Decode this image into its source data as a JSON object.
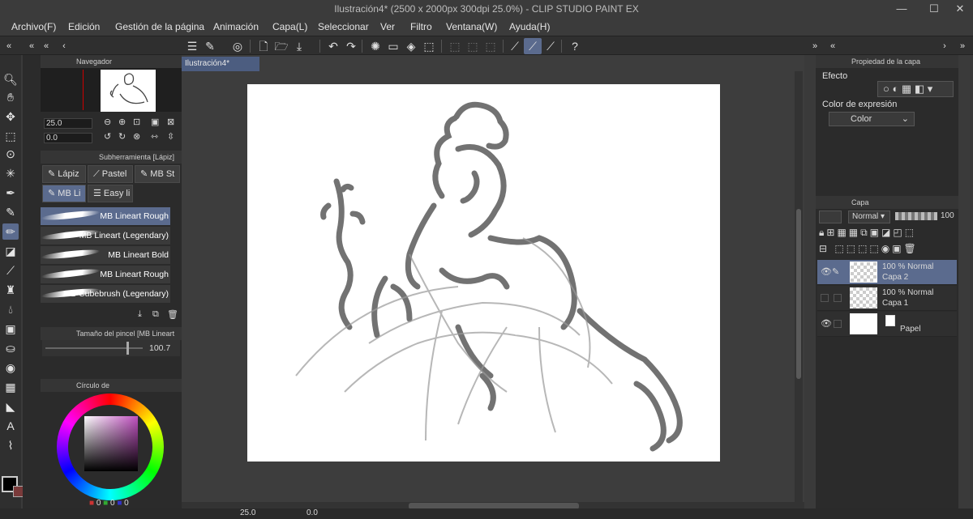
{
  "window": {
    "title": "Ilustración4* (2500 x 2000px 300dpi 25.0%) - CLIP STUDIO PAINT EX",
    "min_icon": "minimize-icon",
    "max_icon": "maximize-icon",
    "close_icon": "close-icon"
  },
  "menu": [
    "Archivo(F)",
    "Edición",
    "Gestión de la página",
    "Animación",
    "Capa(L)",
    "Seleccionar",
    "Ver",
    "Filtro",
    "Ventana(W)",
    "Ayuda(H)"
  ],
  "navigator": {
    "title": "Navegador",
    "zoom": "25.0",
    "rotation": "0.0"
  },
  "subtool": {
    "title": "Subherramienta [Lápiz]",
    "tabs": [
      "Lápiz",
      "Pastel",
      "MB St",
      "MB Li",
      "Easy li"
    ],
    "brushes": [
      "MB Lineart Rough",
      "MB Lineart (Legendary)",
      "MB Lineart Bold",
      "MB Lineart Rough",
      "MB Cubebrush (Legendary)"
    ]
  },
  "brushsize": {
    "title": "Tamaño del pincel [MB Lineart ",
    "value": "100.7"
  },
  "colorwheel": {
    "title": "Círculo de",
    "r": "0",
    "g": "0",
    "b": "0"
  },
  "canvas": {
    "tab": "Ilustración4*",
    "zoom": "25.0",
    "rotation": "0.0"
  },
  "layerprop": {
    "title": "Propiedad de la capa",
    "effect_label": "Efecto",
    "expression_label": "Color de expresión",
    "expression_value": "Color"
  },
  "layers": {
    "title": "Capa",
    "blend": "Normal",
    "opacity": "100",
    "items": [
      {
        "mode": "100 % Normal",
        "name": "Capa 2"
      },
      {
        "mode": "100 % Normal",
        "name": "Capa 1"
      },
      {
        "mode": "",
        "name": "Papel"
      }
    ]
  },
  "colors": {
    "accent": "#5b6b8e",
    "panel": "#2b2b2b",
    "canvas_bg": "#3d3d3d"
  }
}
